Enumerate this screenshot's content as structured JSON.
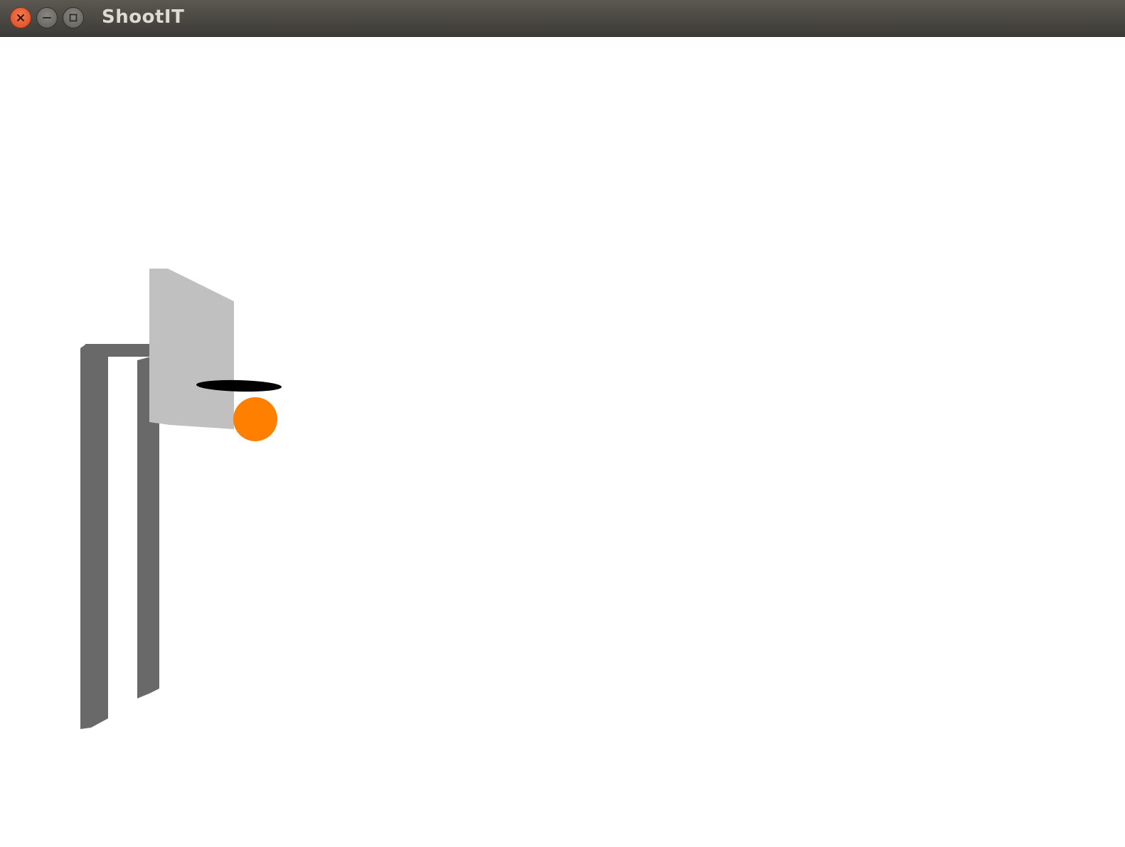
{
  "window": {
    "title": "ShootIT",
    "controls": [
      {
        "name": "close",
        "icon": "close-icon"
      },
      {
        "name": "minimize",
        "icon": "minimize-icon"
      },
      {
        "name": "maximize",
        "icon": "maximize-icon"
      }
    ]
  },
  "scene": {
    "background_color": "#ffffff",
    "pole_color": "#696969",
    "backboard_color": "#c0c0c0",
    "rim_color": "#000000",
    "ball_color": "#ff7f00"
  }
}
